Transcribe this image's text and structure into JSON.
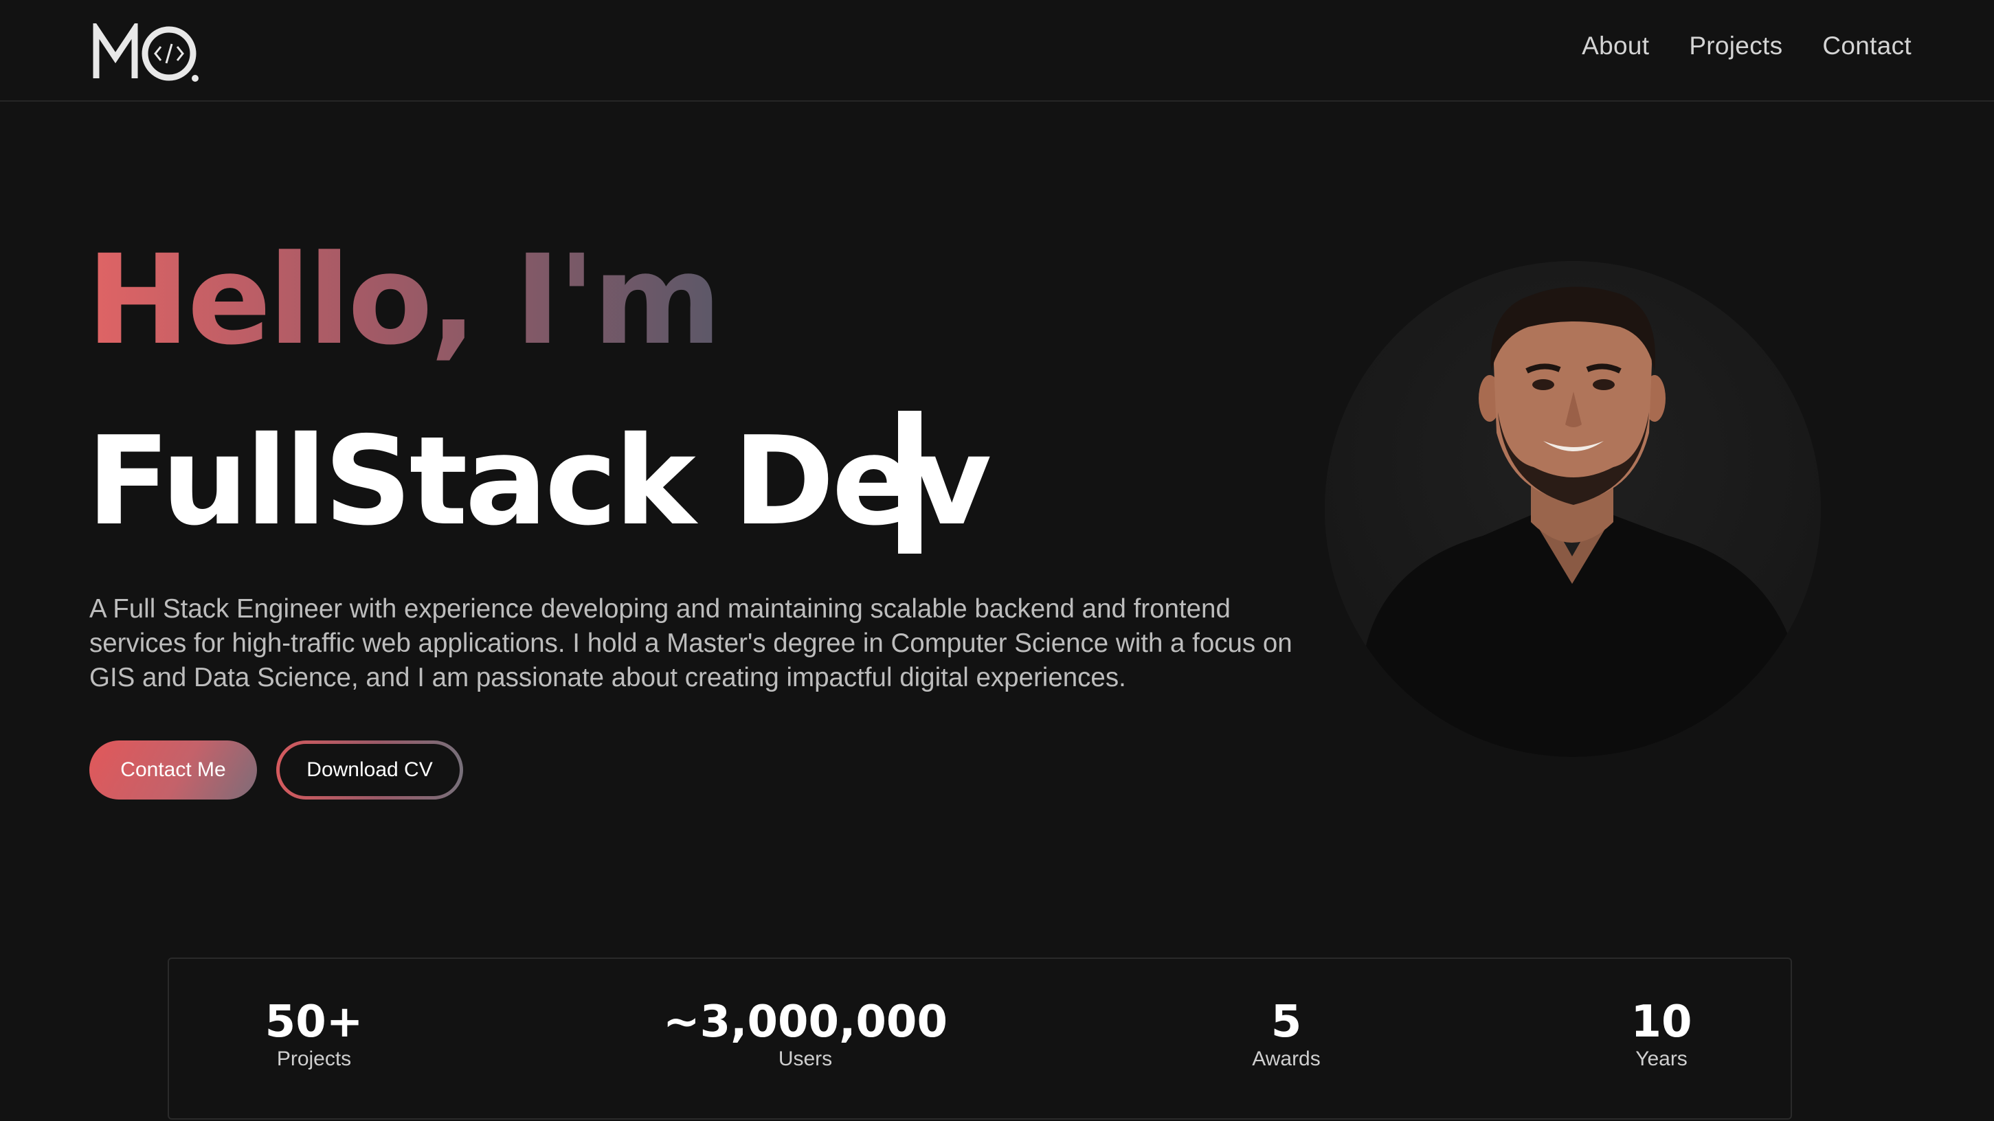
{
  "nav": {
    "logo_text": "MO",
    "links": [
      "About",
      "Projects",
      "Contact"
    ]
  },
  "hero": {
    "greeting": "Hello, I'm",
    "role": "FullStack Dev",
    "description": "A Full Stack Engineer with experience developing and maintaining scalable backend and frontend services for high-traffic web applications. I hold a Master's degree in Computer Science with a focus on GIS and Data Science, and I am passionate about creating impactful digital experiences.",
    "primary_button": "Contact Me",
    "secondary_button": "Download CV"
  },
  "stats": [
    {
      "value": "50+",
      "label": "Projects"
    },
    {
      "value": "~3,000,000",
      "label": "Users"
    },
    {
      "value": "5",
      "label": "Awards"
    },
    {
      "value": "10",
      "label": "Years"
    }
  ],
  "colors": {
    "background": "#121212",
    "accent_start": "#e06465",
    "accent_end": "#5c5868"
  }
}
